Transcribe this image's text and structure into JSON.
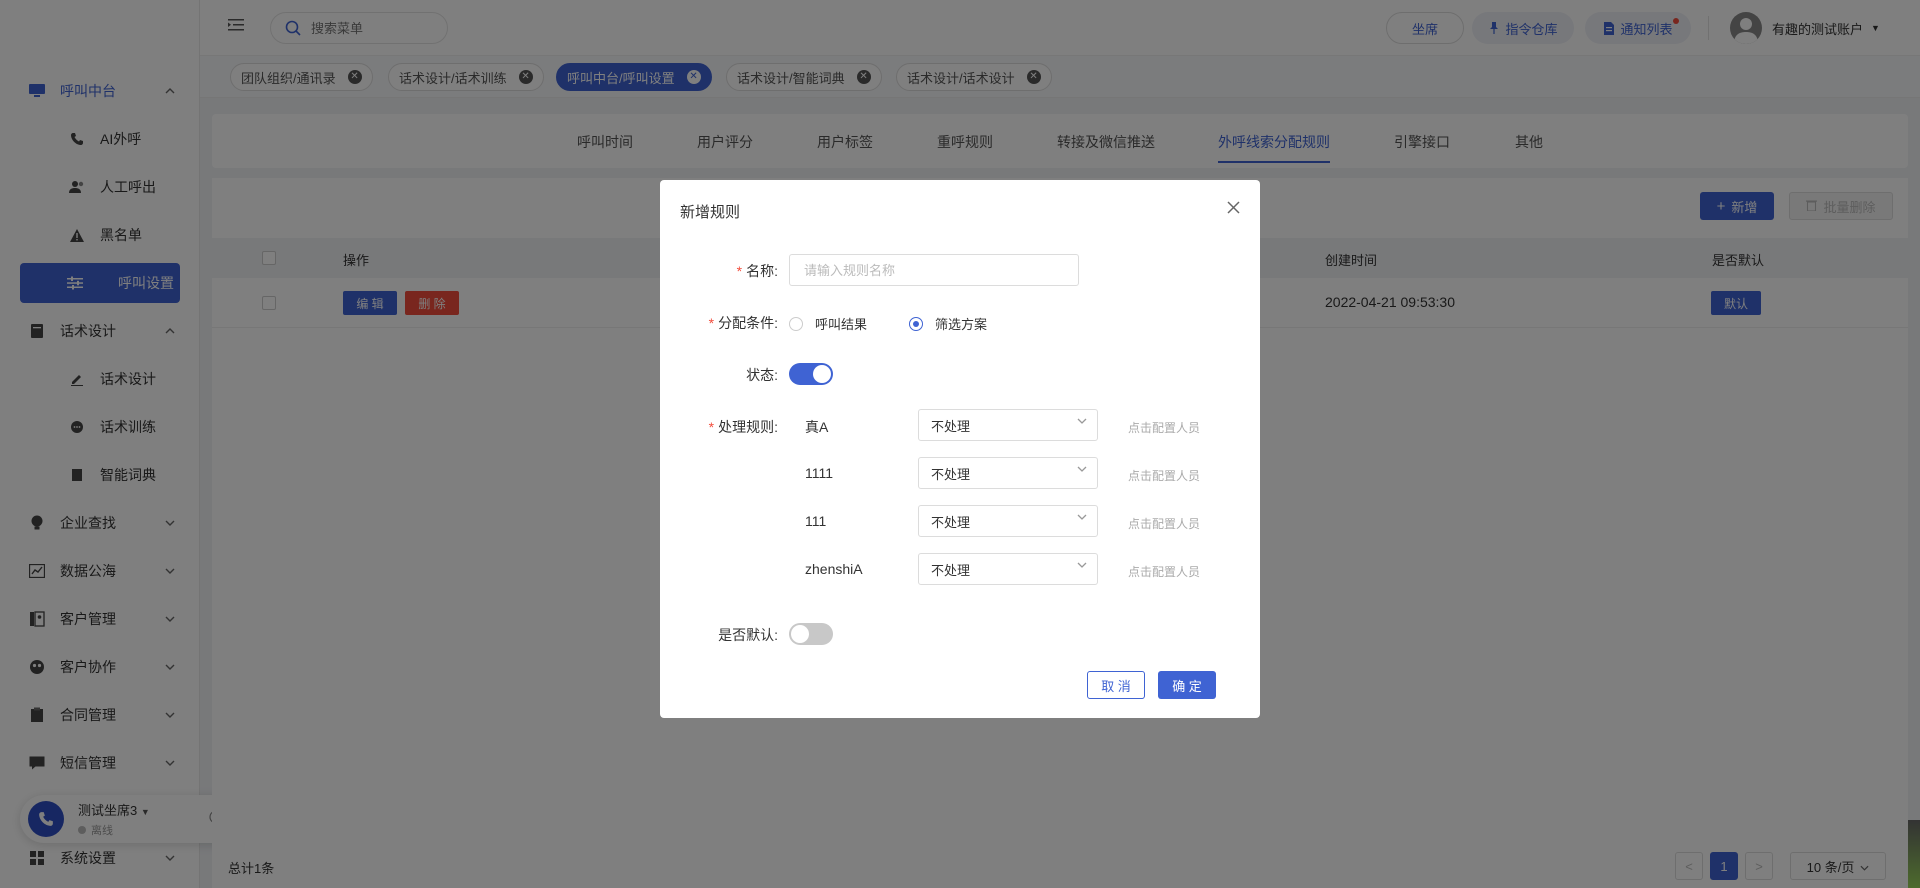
{
  "sidebar": {
    "call_center": "呼叫中台",
    "ai_call": "AI外呼",
    "manual_call": "人工呼出",
    "blacklist": "黑名单",
    "call_settings": "呼叫设置",
    "script_design_group": "话术设计",
    "script_design": "话术设计",
    "script_training": "话术训练",
    "smart_dictionary": "智能词典",
    "enterprise_search": "企业查找",
    "data_sea": "数据公海",
    "customer_mgmt": "客户管理",
    "customer_collab": "客户协作",
    "contract_mgmt": "合同管理",
    "sms_mgmt": "短信管理",
    "system_settings": "系统设置"
  },
  "phone_widget": {
    "seat_name": "测试坐席3",
    "status": "离线"
  },
  "topbar": {
    "search_placeholder": "搜索菜单",
    "seat": "坐席",
    "command_repo": "指令仓库",
    "notice_list": "通知列表",
    "user_name": "有趣的测试账户"
  },
  "tags": [
    "团队组织/通讯录",
    "话术设计/话术训练",
    "呼叫中台/呼叫设置",
    "话术设计/智能词典",
    "话术设计/话术设计"
  ],
  "subtabs": [
    "呼叫时间",
    "用户评分",
    "用户标签",
    "重呼规则",
    "转接及微信推送",
    "外呼线索分配规则",
    "引擎接口",
    "其他"
  ],
  "toolbar": {
    "add": "新增",
    "batch_delete": "批量删除"
  },
  "table": {
    "headers": {
      "action": "操作",
      "created": "创建时间",
      "is_default": "是否默认"
    },
    "row": {
      "edit": "编 辑",
      "delete": "删 除",
      "created": "2022-04-21 09:53:30",
      "default": "默认"
    }
  },
  "footer": {
    "total": "总计1条",
    "page": "1",
    "page_size": "10 条/页"
  },
  "modal": {
    "title": "新增规则",
    "name_label": "名称:",
    "name_placeholder": "请输入规则名称",
    "condition_label": "分配条件:",
    "option_call_result": "呼叫结果",
    "option_filter": "筛选方案",
    "status_label": "状态:",
    "rule_label": "处理规则:",
    "rules": [
      {
        "name": "真A",
        "action": "不处理",
        "config": "点击配置人员"
      },
      {
        "name": "1111",
        "action": "不处理",
        "config": "点击配置人员"
      },
      {
        "name": "111",
        "action": "不处理",
        "config": "点击配置人员"
      },
      {
        "name": "zhenshiA",
        "action": "不处理",
        "config": "点击配置人员"
      }
    ],
    "default_label": "是否默认:",
    "cancel": "取 消",
    "confirm": "确 定"
  },
  "colors": {
    "primary": "#3f63d3",
    "danger": "#f24c3c"
  }
}
